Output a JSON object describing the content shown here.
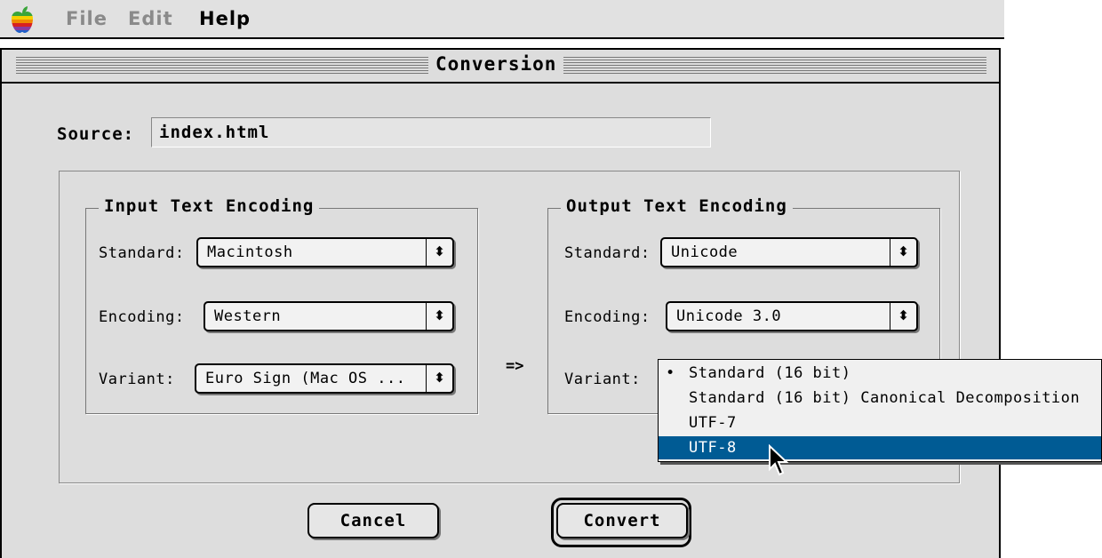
{
  "menubar": {
    "items": [
      {
        "label": "File",
        "enabled": false
      },
      {
        "label": "Edit",
        "enabled": false
      },
      {
        "label": "Help",
        "enabled": true
      }
    ]
  },
  "window": {
    "title": "Conversion"
  },
  "source": {
    "label": "Source:",
    "value": "index.html"
  },
  "input_encoding": {
    "title": "Input Text Encoding",
    "standard_label": "Standard:",
    "standard_value": "Macintosh",
    "encoding_label": "Encoding:",
    "encoding_value": "Western",
    "variant_label": "Variant:",
    "variant_value": "Euro Sign (Mac OS ..."
  },
  "separator": "=>",
  "output_encoding": {
    "title": "Output Text Encoding",
    "standard_label": "Standard:",
    "standard_value": "Unicode",
    "encoding_label": "Encoding:",
    "encoding_value": "Unicode 3.0",
    "variant_label": "Variant:"
  },
  "variant_menu": {
    "options": [
      {
        "label": "Standard (16 bit)",
        "checked": true,
        "highlighted": false
      },
      {
        "label": "Standard (16 bit) Canonical Decomposition",
        "checked": false,
        "highlighted": false
      },
      {
        "label": "UTF-7",
        "checked": false,
        "highlighted": false
      },
      {
        "label": "UTF-8",
        "checked": false,
        "highlighted": true
      }
    ],
    "check_glyph": "•"
  },
  "buttons": {
    "cancel": "Cancel",
    "convert": "Convert"
  },
  "colors": {
    "highlight": "#005b94",
    "window_bg": "#dddddd"
  },
  "icons": {
    "apple": "apple-logo-icon",
    "popup_arrow": "up-down-arrows-icon",
    "cursor": "arrow-pointer-icon"
  }
}
